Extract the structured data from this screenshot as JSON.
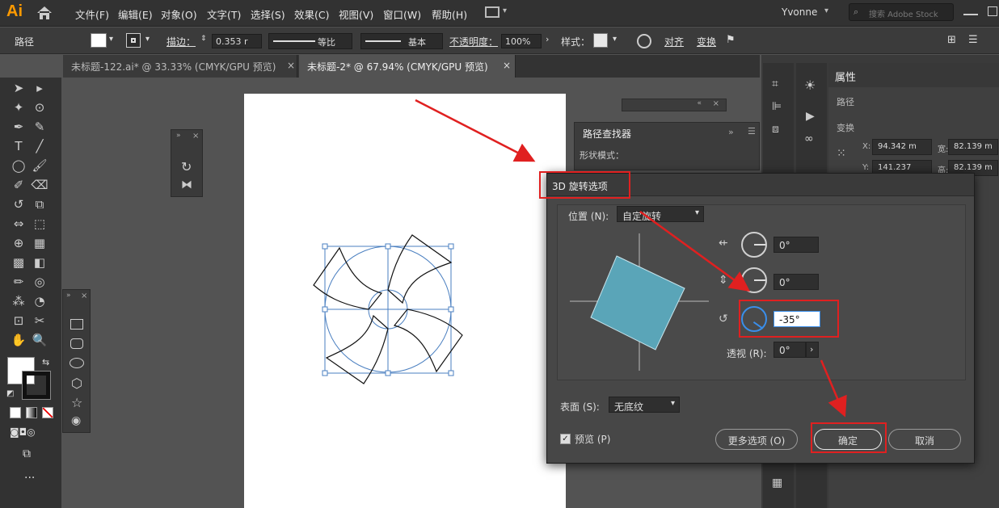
{
  "menubar": {
    "logo": "Ai",
    "items": [
      "文件(F)",
      "编辑(E)",
      "对象(O)",
      "文字(T)",
      "选择(S)",
      "效果(C)",
      "视图(V)",
      "窗口(W)",
      "帮助(H)"
    ],
    "user": "Yvonne",
    "search_placeholder": "搜索 Adobe Stock"
  },
  "control": {
    "selection": "路径",
    "stroke_label": "描边：",
    "stroke_value": "0.353 r",
    "stroke_profile": "等比",
    "brush": "基本",
    "opacity_label": "不透明度：",
    "opacity": "100%",
    "style_label": "样式：",
    "align": "对齐",
    "transform": "变换"
  },
  "tabs": [
    {
      "label": "未标题-122.ai* @ 33.33% (CMYK/GPU 预览)",
      "close": "×"
    },
    {
      "label": "未标题-2* @ 67.94% (CMYK/GPU 预览)",
      "close": "×"
    }
  ],
  "pathfinder": {
    "title": "路径查找器",
    "section": "形状模式："
  },
  "properties": {
    "tab": "属性",
    "section1": "路径",
    "section2": "变换",
    "x_label": "X:",
    "x": "94.342 m",
    "w_label": "宽:",
    "w": "82.139 m",
    "y_label": "Y:",
    "y": "141.237",
    "h_label": "高:",
    "h": "82.139 m"
  },
  "dialog": {
    "title": "3D 旋转选项",
    "position_label": "位置 (N):",
    "position_value": "自定旋转",
    "x_angle": "0°",
    "y_angle": "0°",
    "z_angle": "-35°",
    "perspective_label": "透视 (R):",
    "perspective": "0°",
    "surface_label": "表面 (S):",
    "surface_value": "无底纹",
    "preview_label": "预览 (P)",
    "more_options": "更多选项 (O)",
    "ok": "确定",
    "cancel": "取消"
  },
  "colors": {
    "accent": "#ff9a00",
    "cube": "#5aa5b8",
    "highlight": "#e02020",
    "selection": "#4a7fc0"
  }
}
